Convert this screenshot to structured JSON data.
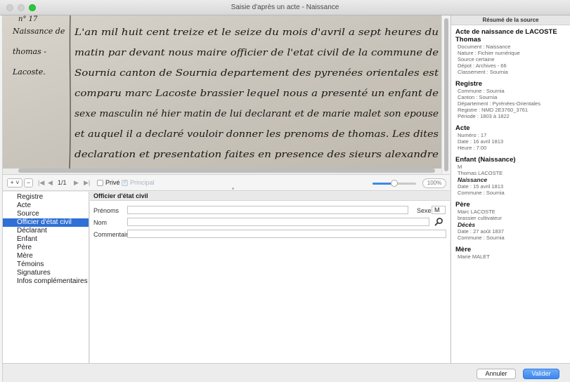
{
  "window": {
    "title": "Saisie d'après un acte - Naissance"
  },
  "document_image": {
    "transcript_lines": [
      "L'an mil huit cent treize et le seize du mois d'avril a sept heures du",
      "matin par devant nous maire officier de l'etat civil de la commune de",
      "Sournia canton de Sournia departement des pyrenées orientales est",
      "comparu marc Lacoste brassier lequel nous a presenté un enfant de",
      "sexe masculin né hier matin de lui declarant et de marie malet son epouse",
      "et auquel il a declaré vouloir donner les prenoms de thomas. Les dites",
      "declaration et presentation faites en presence des sieurs alexandre"
    ],
    "margin_lines": [
      "Naissance de",
      "thomas -",
      "Lacoste."
    ],
    "top_fragment": "n° 17"
  },
  "image_toolbar": {
    "add_label": "+ ˅",
    "remove_label": "−",
    "page_indicator": "1/1",
    "first_glyph": "|◀",
    "prev_glyph": "◀",
    "next_glyph": "▶",
    "last_glyph": "▶|",
    "prive_label": "Privé",
    "principal_label": "Principal",
    "zoom_label": "100%",
    "zoom_level": 0.5
  },
  "nav": {
    "items": [
      {
        "label": "Registre"
      },
      {
        "label": "Acte"
      },
      {
        "label": "Source"
      },
      {
        "label": "Officier d'état civil"
      },
      {
        "label": "Déclarant"
      },
      {
        "label": "Enfant"
      },
      {
        "label": "Père"
      },
      {
        "label": "Mère"
      },
      {
        "label": "Témoins"
      },
      {
        "label": "Signatures"
      },
      {
        "label": "Infos complémentaires"
      }
    ],
    "selected_index": 3
  },
  "form": {
    "title": "Officier d'état civil",
    "prenoms_label": "Prénoms",
    "prenoms_value": "",
    "sexe_label": "Sexe",
    "sexe_value": "M",
    "nom_label": "Nom",
    "nom_value": "",
    "commentaire_label": "Commentaire",
    "commentaire_value": ""
  },
  "summary": {
    "header": "Résumé de la source",
    "acte_title": "Acte de naissance de LACOSTE",
    "acte_name": "Thomas",
    "acte_lines": [
      "Document : Naissance",
      "Nature : Fichier numérique",
      "Source certaine",
      "Dépot : Archives - 66",
      "Classement : Sournia"
    ],
    "registre_title": "Registre",
    "registre_lines": [
      "Commune : Sournia",
      "Canton : Sournia",
      "Département : Pyrénées-Orientales",
      "Registre : NMD 2E3760_3761",
      "Période : 1803 à 1822"
    ],
    "acte2_title": "Acte",
    "acte2_lines": [
      "Numéro : 17",
      "Date : 16 avril 1813",
      "Heure : 7:00"
    ],
    "enfant_title": "Enfant (Naissance)",
    "enfant_lines": [
      "M",
      "Thomas LACOSTE"
    ],
    "enfant_event": "Naissance",
    "enfant_event_lines": [
      "Date : 15 avril 1813",
      "Commune : Sournia"
    ],
    "pere_title": "Père",
    "pere_lines": [
      "Marc LACOSTE",
      "brassier cultivateur"
    ],
    "pere_event": "Décès",
    "pere_event_lines": [
      "Date : 27 août 1837",
      "Commune : Sournia"
    ],
    "mere_title": "Mère",
    "mere_lines": [
      "Marie MALET"
    ]
  },
  "buttons": {
    "cancel": "Annuler",
    "ok": "Valider"
  },
  "colors": {
    "accent": "#2f6fd6",
    "valider": "#3d86ee",
    "paper": "#cfcbc3",
    "ink": "#1a1612"
  }
}
